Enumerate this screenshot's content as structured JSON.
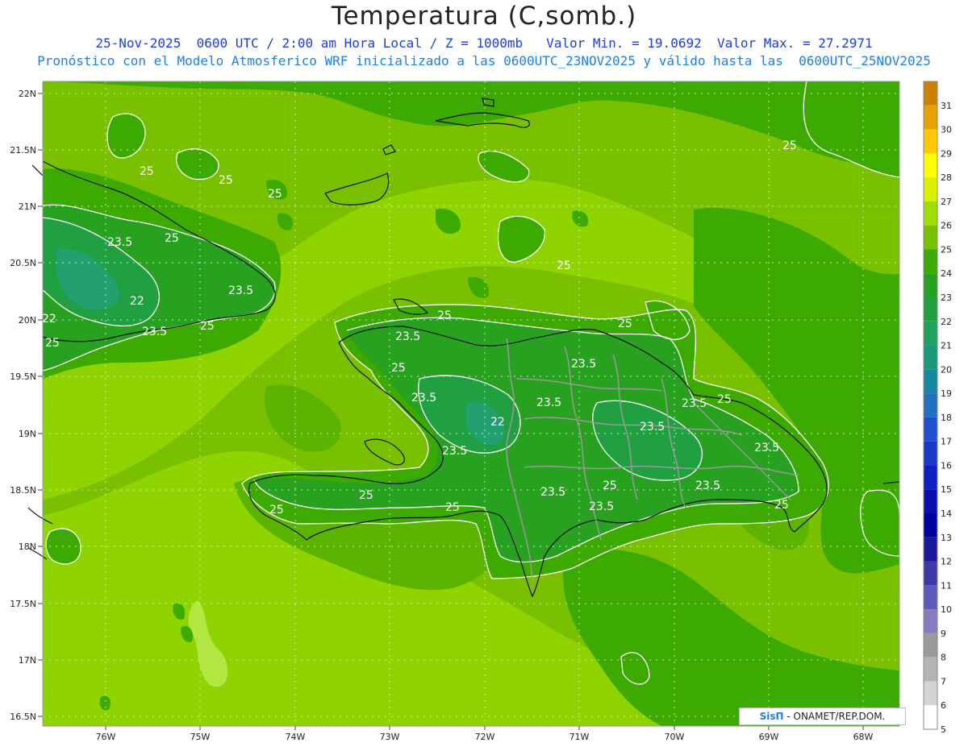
{
  "title": "Temperatura (C,somb.)",
  "subtitle_line1": "25-Nov-2025  0600 UTC / 2:00 am Hora Local / Z = 1000mb   Valor Min. = 19.0692  Valor Max. = 27.2971",
  "subtitle_line2": "Pronóstico con el Modelo Atmosferico WRF inicializado a las 0600UTC_23NOV2025 y válido hasta las  0600UTC_25NOV2025",
  "credit": {
    "brand": "SisΠ",
    "rest": " - ONAMET/REP.DOM."
  },
  "lat_labels": [
    "22N",
    "21.5N",
    "21N",
    "20.5N",
    "20N",
    "19.5N",
    "19N",
    "18.5N",
    "18N",
    "17.5N",
    "17N",
    "16.5N"
  ],
  "lon_labels": [
    "76W",
    "75W",
    "74W",
    "73W",
    "72W",
    "71W",
    "70W",
    "69W",
    "68W"
  ],
  "colorbar": {
    "labels": [
      "31",
      "30",
      "29",
      "28",
      "27",
      "26",
      "25",
      "24",
      "23",
      "22",
      "21",
      "20",
      "19",
      "18",
      "17",
      "16",
      "15",
      "14",
      "13",
      "12",
      "11",
      "10",
      "9",
      "8",
      "7",
      "6",
      "5"
    ],
    "colors": [
      "#c88200",
      "#e6a000",
      "#ffc800",
      "#ffff00",
      "#dcf000",
      "#a0dc00",
      "#78c000",
      "#3caa00",
      "#28a020",
      "#20a040",
      "#22a060",
      "#1a9a7a",
      "#1888a0",
      "#2470c0",
      "#2050d0",
      "#1838c8",
      "#1020c0",
      "#0a10b0",
      "#0000a0",
      "#1a1a9a",
      "#3a3aa8",
      "#5a5ab8",
      "#8a7ac0",
      "#9a9a9a",
      "#b4b4b4",
      "#d4d4d4",
      "#ffffff"
    ]
  },
  "contour_labels": [
    "25",
    "25",
    "25",
    "25",
    "25",
    "25",
    "25",
    "25",
    "25",
    "25",
    "25",
    "25",
    "25",
    "25",
    "25",
    "23.5",
    "23.5",
    "23.5",
    "23.5",
    "23.5",
    "23.5",
    "23.5",
    "23.5",
    "23.5",
    "23.5",
    "23.5",
    "23.5",
    "23.5",
    "23.5",
    "22",
    "22",
    "22"
  ]
}
